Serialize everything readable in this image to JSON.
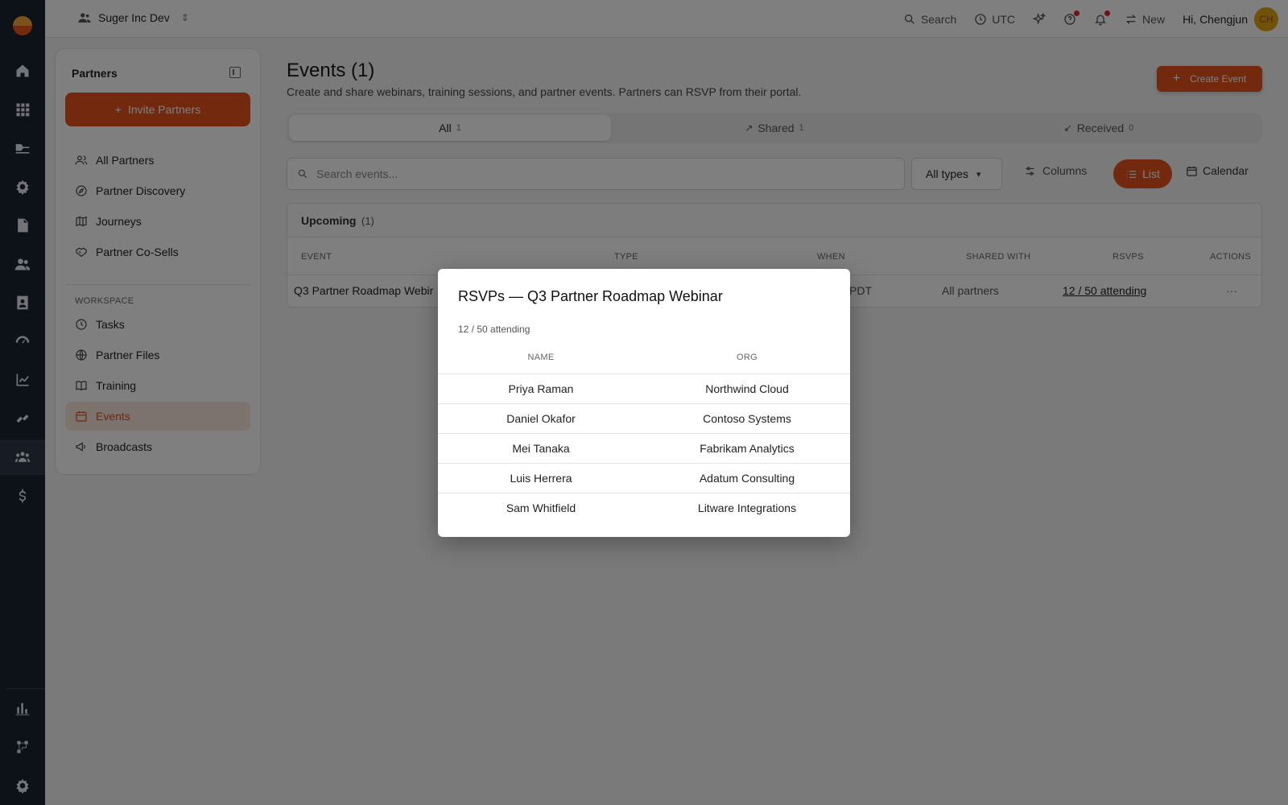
{
  "rail": {
    "icons": [
      "home-icon",
      "apps-grid-icon",
      "marketplace-icon",
      "settings-gear-icon",
      "document-icon",
      "people-icon",
      "contacts-icon",
      "gauge-icon",
      "chart-line-icon",
      "integration-icon",
      "partners-icon",
      "dollar-icon",
      "bar-chart-icon",
      "workflow-icon",
      "gear-icon"
    ]
  },
  "topbar": {
    "org_name": "Suger Inc Dev",
    "search_label": "Search",
    "timezone_label": "UTC",
    "new_label": "New",
    "greeting": "Hi, Chengjun",
    "avatar_initials": "CH"
  },
  "sidebar": {
    "title": "Partners",
    "invite_label": "Invite Partners",
    "items": [
      {
        "label": "All Partners",
        "icon": "users-icon"
      },
      {
        "label": "Partner Discovery",
        "icon": "compass-icon"
      },
      {
        "label": "Journeys",
        "icon": "map-icon"
      },
      {
        "label": "Partner Co-Sells",
        "icon": "handshake-icon"
      }
    ],
    "workspace_label": "WORKSPACE",
    "workspace_items": [
      {
        "label": "Tasks",
        "icon": "clock-icon"
      },
      {
        "label": "Partner Files",
        "icon": "globe-icon"
      },
      {
        "label": "Training",
        "icon": "book-icon"
      },
      {
        "label": "Events",
        "icon": "calendar-icon",
        "active": true
      },
      {
        "label": "Broadcasts",
        "icon": "megaphone-icon"
      }
    ]
  },
  "main": {
    "title": "Events (1)",
    "subtitle": "Create and share webinars, training sessions, and partner events. Partners can RSVP from their portal.",
    "create_label": "Create Event",
    "tabs": [
      {
        "label": "All",
        "count": "1",
        "active": true
      },
      {
        "label": "Shared",
        "count": "1"
      },
      {
        "label": "Received",
        "count": "0"
      }
    ],
    "search_placeholder": "Search events...",
    "type_filter": "All types",
    "columns_label": "Columns",
    "list_label": "List",
    "calendar_label": "Calendar",
    "section_title": "Upcoming",
    "section_count": "(1)",
    "headers": [
      "EVENT",
      "TYPE",
      "WHEN",
      "SHARED WITH",
      "RSVPS",
      "ACTIONS"
    ],
    "row": {
      "event": "Q3 Partner Roadmap Webir",
      "when": "PDT",
      "shared_with": "All partners",
      "rsvps": "12 / 50 attending",
      "actions": "···"
    }
  },
  "modal": {
    "title": "RSVPs — Q3 Partner Roadmap Webinar",
    "subtitle": "12 / 50 attending",
    "col_name": "NAME",
    "col_org": "ORG",
    "rows": [
      {
        "name": "Priya Raman",
        "org": "Northwind Cloud"
      },
      {
        "name": "Daniel Okafor",
        "org": "Contoso Systems"
      },
      {
        "name": "Mei Tanaka",
        "org": "Fabrikam Analytics"
      },
      {
        "name": "Luis Herrera",
        "org": "Adatum Consulting"
      },
      {
        "name": "Sam Whitfield",
        "org": "Litware Integrations"
      }
    ]
  },
  "colors": {
    "accent": "#e4531a",
    "rail_bg": "#1b2230",
    "active_nav_bg": "#fbe6dc"
  }
}
